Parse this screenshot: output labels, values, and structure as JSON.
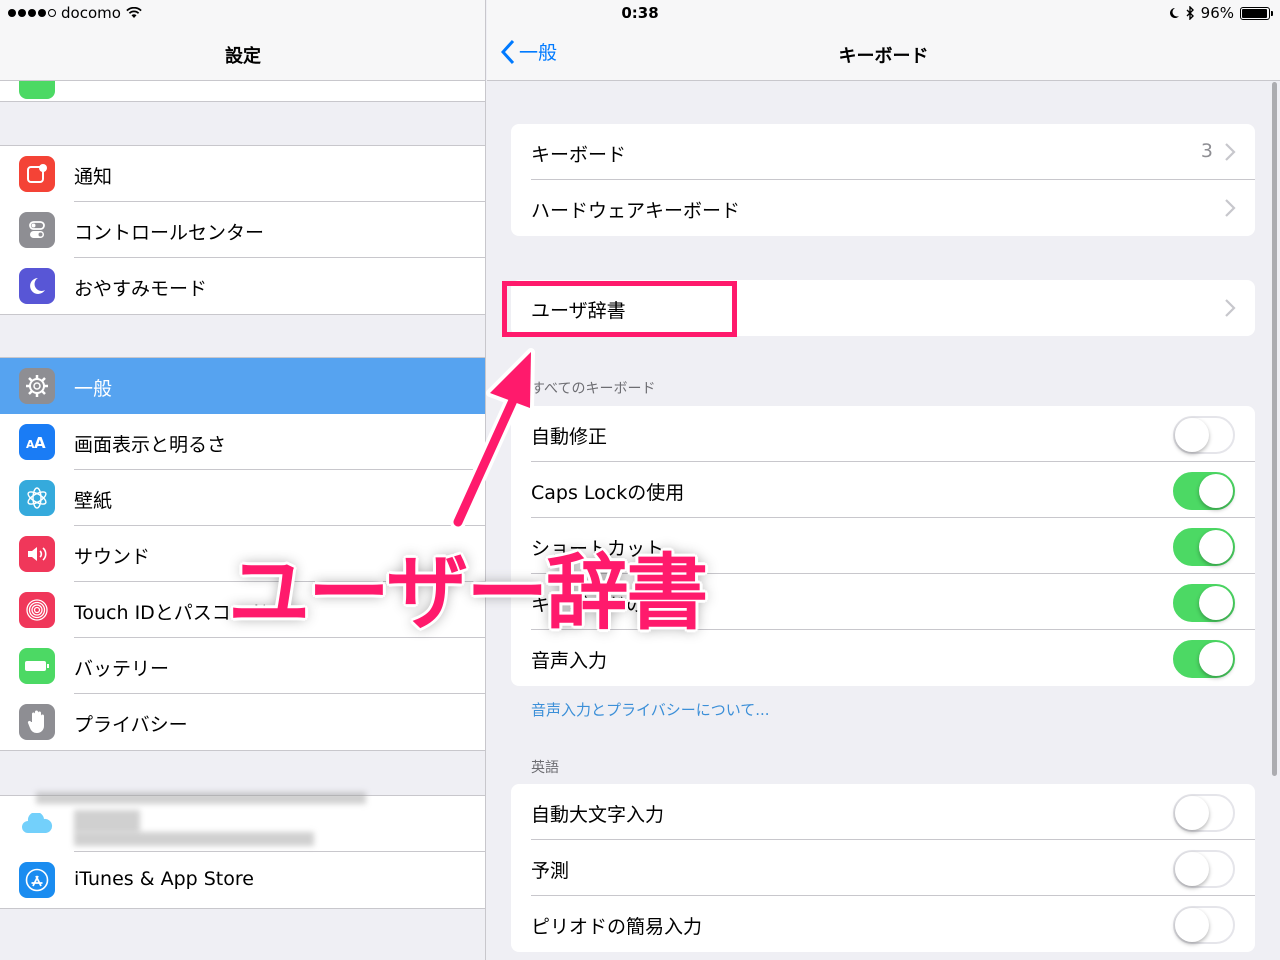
{
  "status_bar": {
    "carrier": "docomo",
    "time": "0:38",
    "battery": "96%",
    "battery_level": 0.96
  },
  "left_pane": {
    "title": "設定",
    "groups": [
      {
        "items": [
          {
            "label": "通知",
            "icon": "notifications-icon",
            "color": "#f44336"
          },
          {
            "label": "コントロールセンター",
            "icon": "control-center-icon",
            "color": "#8e8e93"
          },
          {
            "label": "おやすみモード",
            "icon": "moon-icon",
            "color": "#5856d6"
          }
        ]
      },
      {
        "items": [
          {
            "label": "一般",
            "icon": "gear-icon",
            "color": "#8e8e93",
            "selected": true
          },
          {
            "label": "画面表示と明るさ",
            "icon": "display-icon",
            "color": "#1a7cf5"
          },
          {
            "label": "壁紙",
            "icon": "wallpaper-icon",
            "color": "#35aadc"
          },
          {
            "label": "サウンド",
            "icon": "speaker-icon",
            "color": "#f0375a"
          },
          {
            "label": "Touch IDとパスコード",
            "icon": "fingerprint-icon",
            "color": "#f0375a"
          },
          {
            "label": "バッテリー",
            "icon": "battery-icon",
            "color": "#4cd964"
          },
          {
            "label": "プライバシー",
            "icon": "hand-icon",
            "color": "#8e8e93"
          }
        ]
      },
      {
        "items": [
          {
            "label": "",
            "icon": "icloud-icon",
            "color": "#5ac8fa"
          },
          {
            "label": "iTunes & App Store",
            "icon": "app-store-icon",
            "color": "#1a8cf0"
          }
        ]
      }
    ]
  },
  "right_pane": {
    "back_label": "一般",
    "title": "キーボード",
    "group1": [
      {
        "label": "キーボード",
        "value": "3"
      },
      {
        "label": "ハードウェアキーボード",
        "value": ""
      }
    ],
    "group2": [
      {
        "label": "ユーザ辞書"
      }
    ],
    "all_keyboards_header": "すべてのキーボード",
    "group3": [
      {
        "label": "自動修正",
        "on": false
      },
      {
        "label": "Caps Lockの使用",
        "on": true
      },
      {
        "label": "ショートカット",
        "on": true
      },
      {
        "label": "キーボードの表示",
        "on": true
      },
      {
        "label": "音声入力",
        "on": true
      }
    ],
    "privacy_link": "音声入力とプライバシーについて...",
    "english_header": "英語",
    "group4": [
      {
        "label": "自動大文字入力",
        "on": false
      },
      {
        "label": "予測",
        "on": false
      },
      {
        "label": "ピリオドの簡易入力",
        "on": false
      }
    ]
  },
  "annotation": {
    "text": "ユーザー辞書",
    "color": "#ff1a6c"
  }
}
